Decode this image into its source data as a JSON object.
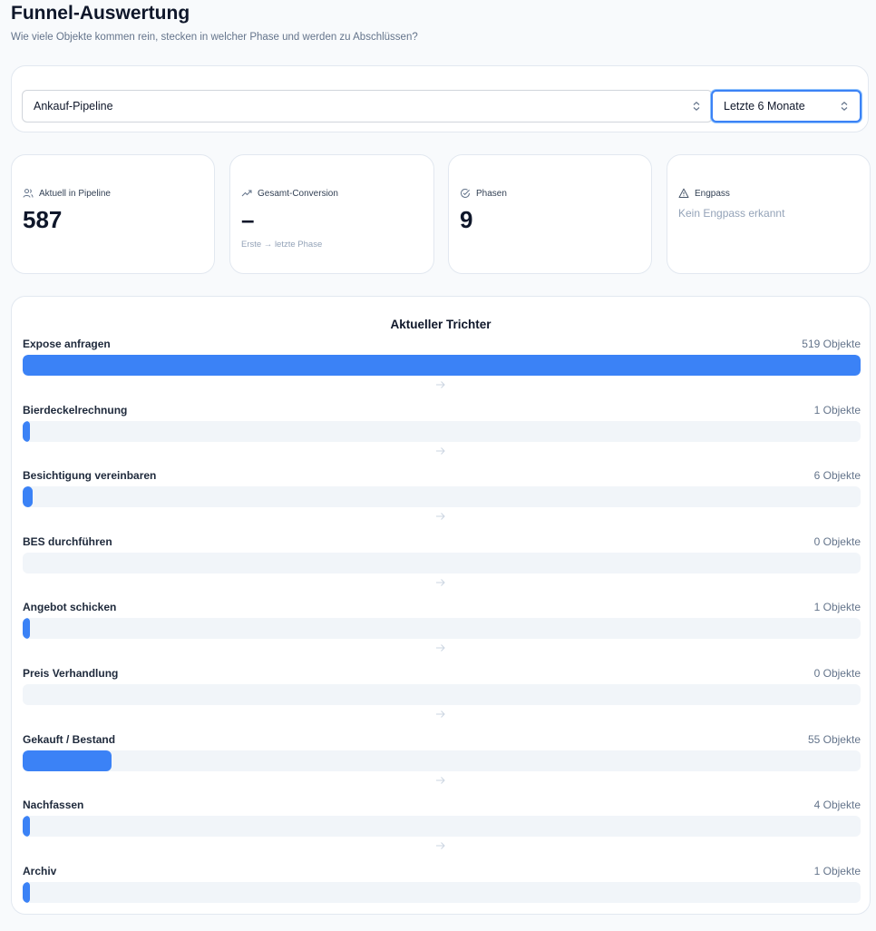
{
  "header": {
    "title": "Funnel-Auswertung",
    "subtitle": "Wie viele Objekte kommen rein, stecken in welcher Phase und werden zu Abschlüssen?"
  },
  "filters": {
    "pipeline": "Ankauf-Pipeline",
    "period": "Letzte 6 Monate"
  },
  "kpis": {
    "pipeline": {
      "label": "Aktuell in Pipeline",
      "value": "587",
      "icon": "users-icon"
    },
    "conversion": {
      "label": "Gesamt-Conversion",
      "value": "–",
      "note": "Erste → letzte Phase",
      "icon": "trending-up-icon"
    },
    "phases": {
      "label": "Phasen",
      "value": "9",
      "icon": "check-circle-icon"
    },
    "bottleneck": {
      "label": "Engpass",
      "message": "Kein Engpass erkannt",
      "icon": "warning-triangle-icon"
    }
  },
  "funnel": {
    "title": "Aktueller Trichter",
    "max": 519,
    "stages": [
      {
        "name": "Expose anfragen",
        "count": 519,
        "count_label": "519 Objekte"
      },
      {
        "name": "Bierdeckelrechnung",
        "count": 1,
        "count_label": "1 Objekte"
      },
      {
        "name": "Besichtigung vereinbaren",
        "count": 6,
        "count_label": "6 Objekte"
      },
      {
        "name": "BES durchführen",
        "count": 0,
        "count_label": "0 Objekte"
      },
      {
        "name": "Angebot schicken",
        "count": 1,
        "count_label": "1 Objekte"
      },
      {
        "name": "Preis Verhandlung",
        "count": 0,
        "count_label": "0 Objekte"
      },
      {
        "name": "Gekauft / Bestand",
        "count": 55,
        "count_label": "55 Objekte"
      },
      {
        "name": "Nachfassen",
        "count": 4,
        "count_label": "4 Objekte"
      },
      {
        "name": "Archiv",
        "count": 1,
        "count_label": "1 Objekte"
      }
    ]
  },
  "colors": {
    "bar": "#3b82f6",
    "track": "#f1f5f9",
    "focus": "#3b82f6"
  }
}
